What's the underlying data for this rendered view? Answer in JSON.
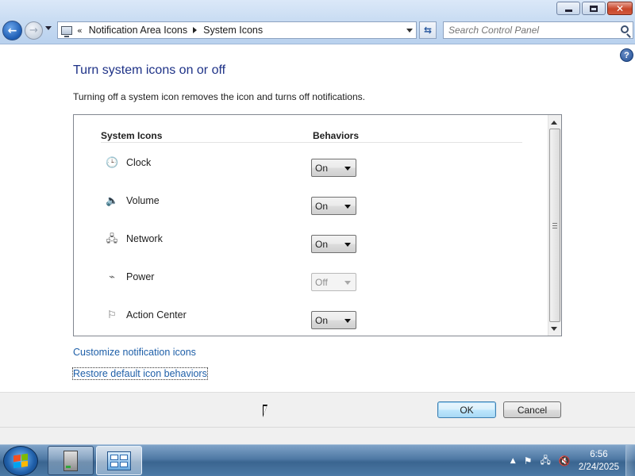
{
  "window": {
    "controls": {
      "minimize_icon": "minimize-icon",
      "maximize_icon": "restore-icon",
      "close_glyph": "✕"
    }
  },
  "nav": {
    "back_glyph": "←",
    "forward_glyph": "→"
  },
  "address": {
    "chevron": "«",
    "crumbs": [
      "Notification Area Icons",
      "System Icons"
    ]
  },
  "search": {
    "placeholder": "Search Control Panel"
  },
  "help": {
    "glyph": "?"
  },
  "page": {
    "title": "Turn system icons on or off",
    "description": "Turning off a system icon removes the icon and turns off notifications."
  },
  "table": {
    "headers": {
      "icons": "System Icons",
      "behaviors": "Behaviors"
    },
    "rows": [
      {
        "label": "Clock",
        "icon": "clock-icon",
        "glyph": "🕒",
        "value": "On",
        "enabled": true
      },
      {
        "label": "Volume",
        "icon": "volume-icon",
        "glyph": "🔈",
        "value": "On",
        "enabled": true
      },
      {
        "label": "Network",
        "icon": "network-icon",
        "glyph": "🖧",
        "value": "On",
        "enabled": true
      },
      {
        "label": "Power",
        "icon": "power-icon",
        "glyph": "⌁",
        "value": "Off",
        "enabled": false
      },
      {
        "label": "Action Center",
        "icon": "flag-icon",
        "glyph": "⚐",
        "value": "On",
        "enabled": true
      }
    ]
  },
  "links": {
    "customize": "Customize notification icons",
    "restore": "Restore default icon behaviors"
  },
  "buttons": {
    "ok": "OK",
    "cancel": "Cancel"
  },
  "taskbar": {
    "tray_icons": [
      "show-hidden-icons-icon",
      "action-center-flag-icon",
      "network-icon",
      "volume-muted-icon"
    ],
    "tray_glyphs": [
      "▲",
      "⚑",
      "🖧",
      "🔇"
    ],
    "time": "6:56",
    "date": "2/24/2025"
  }
}
